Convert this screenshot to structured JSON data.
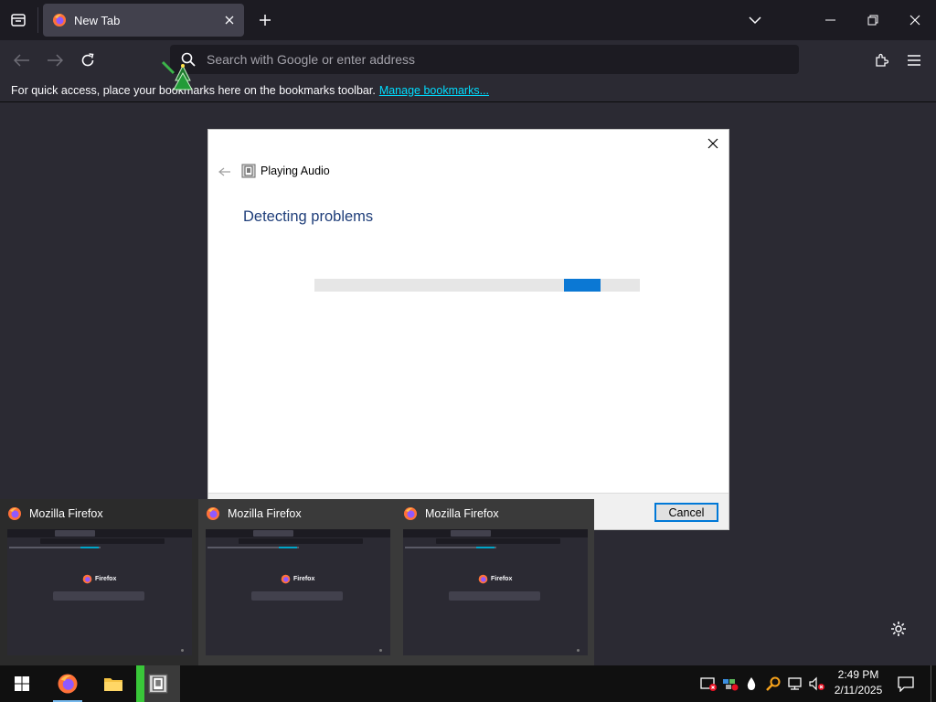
{
  "browser": {
    "tab_title": "New Tab",
    "url_placeholder": "Search with Google or enter address",
    "bookmarks_message": "For quick access, place your bookmarks here on the bookmarks toolbar.",
    "bookmarks_link": "Manage bookmarks..."
  },
  "dialog": {
    "app_title": "Playing Audio",
    "heading": "Detecting problems",
    "cancel_label": "Cancel",
    "progress_state": "indeterminate"
  },
  "previews": [
    {
      "title": "Mozilla Firefox",
      "thumb_logo": "Firefox"
    },
    {
      "title": "Mozilla Firefox",
      "thumb_logo": "Firefox"
    },
    {
      "title": "Mozilla Firefox",
      "thumb_logo": "Firefox"
    }
  ],
  "taskbar": {
    "time": "2:49 PM",
    "date": "2/11/2025",
    "items": [
      "start-icon",
      "firefox-icon",
      "file-explorer-icon",
      "troubleshooter-icon"
    ],
    "tray_icons": [
      "security-alert-icon",
      "network-sharing-icon",
      "droplet-icon",
      "search-key-icon",
      "network-icon",
      "volume-muted-icon"
    ]
  },
  "colors": {
    "accent": "#0b78d4",
    "heading_blue": "#1f3e7a",
    "link": "#00ddff",
    "firefox_orange": "#ff7139"
  }
}
